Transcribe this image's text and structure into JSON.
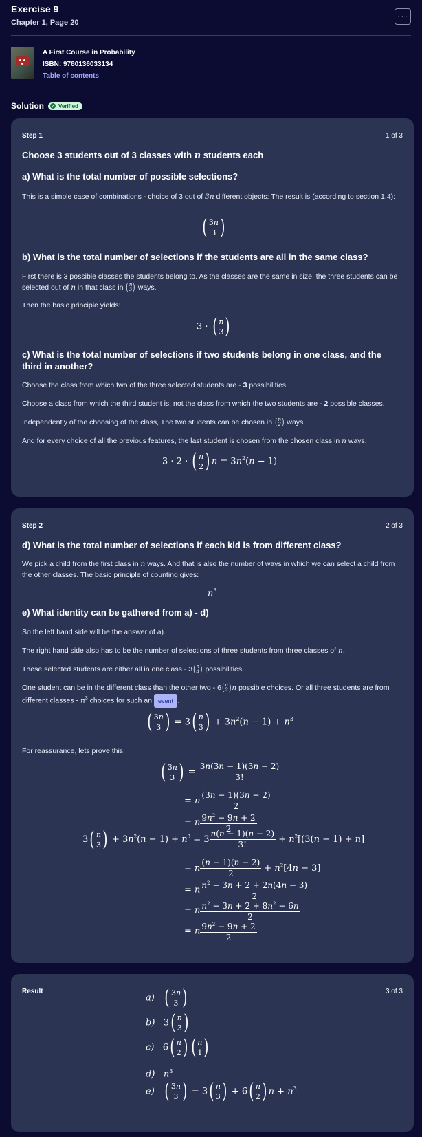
{
  "header": {
    "title": "Exercise 9",
    "subtitle": "Chapter 1, Page 20",
    "more_label": "···"
  },
  "book": {
    "title": "A First Course in Probability",
    "isbn": "ISBN: 9780136033134",
    "toc": "Table of contents"
  },
  "solution": {
    "label": "Solution",
    "badge": "Verified"
  },
  "step1": {
    "label": "Step 1",
    "count": "1 of 3",
    "heading": "Choose 3 students out of 3 classes with",
    "heading_var": "n",
    "heading_tail": "students each",
    "a_title": "a) What is the total number of possible selections?",
    "a_text1": "This is a simple case of combinations - choice of 3 out of",
    "a_text_var": "3n",
    "a_text2": "different objects: The result is (according to section 1.4):",
    "b_title": "b) What is the total number of selections if the students are all in the same class?",
    "b_text1": "First there is 3 possible classes the students belong to. As the classes are the same in size, the three students can be selected out of",
    "b_text_var": "n",
    "b_text2": "in that class in",
    "b_text3": "ways.",
    "b_text4": "Then the basic principle yields:",
    "c_title": "c) What is the total number of selections if two students belong in one class, and the third in another?",
    "c_line1": "Choose the class from which two of the three selected students are -",
    "c_line1_num": "3",
    "c_line1_tail": "possibilities",
    "c_line2": "Choose a class from which the third student is, not the class from which the two students are -",
    "c_line2_num": "2",
    "c_line2_tail": "possible classes.",
    "c_line3": "Independently of the choosing of the class, The two students can be chosen in",
    "c_line3_tail": "ways.",
    "c_line4": "And for every choice of all the previous features, the last student is chosen from the chosen class in",
    "c_line4_var": "n",
    "c_line4_tail": "ways."
  },
  "step2": {
    "label": "Step 2",
    "count": "2 of 3",
    "d_title": "d) What is the total number of selections if each kid is from different class?",
    "d_text1": "We pick a child from the first class in",
    "d_text_var": "n",
    "d_text2": "ways. And that is also the number of ways in which we can select a child from the other classes. The basic principle of counting gives:",
    "e_title": "e) What identity can be gathered from a) - d)",
    "e_line1": "So the left hand side will be the answer of a).",
    "e_line2": "The right hand side also has to be the number of selections of three students from three classes of",
    "e_line2_var": "n.",
    "e_line3": "These selected students are either all in one class -",
    "e_line3_tail": "possibilities.",
    "e_line4a": "One student can be in the different class than the other two -",
    "e_line4b": "possible choices. Or all three students are from different classes -",
    "e_line4c": "choices for such an",
    "e_event": "event",
    "reassure": "For reassurance, lets prove this:"
  },
  "result": {
    "label": "Result",
    "count": "3 of 3",
    "labels": [
      "a)",
      "b)",
      "c)",
      "d)",
      "e)"
    ]
  }
}
